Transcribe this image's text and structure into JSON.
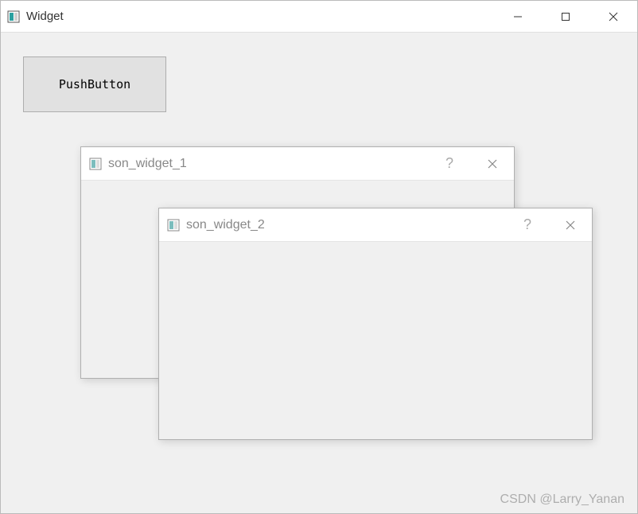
{
  "mainWindow": {
    "title": "Widget",
    "button": "PushButton"
  },
  "subWindows": [
    {
      "title": "son_widget_1"
    },
    {
      "title": "son_widget_2"
    }
  ],
  "watermark": "CSDN @Larry_Yanan"
}
